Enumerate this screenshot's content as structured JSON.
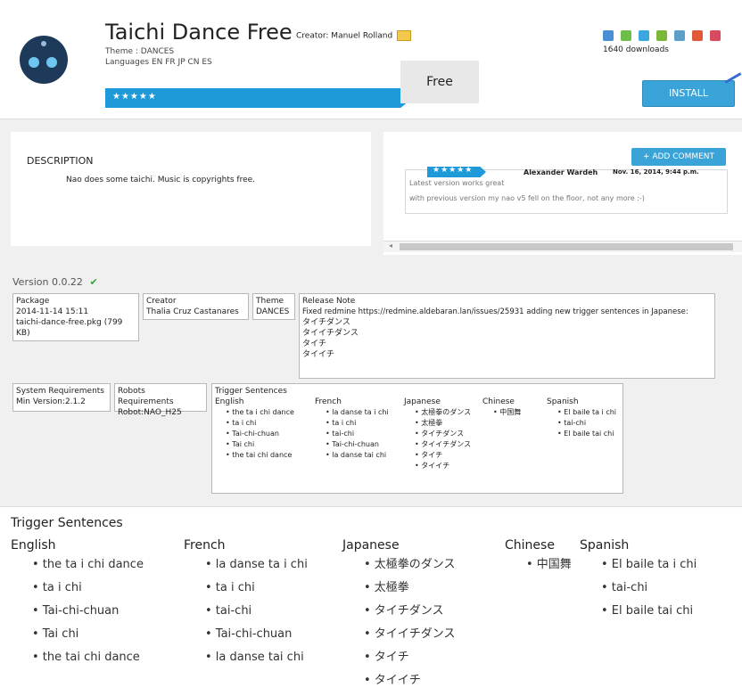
{
  "app": {
    "title": "Taichi Dance Free",
    "creator_label": "Creator: Manuel Rolland",
    "theme_line": "Theme : DANCES",
    "languages_line": "Languages EN FR JP CN ES",
    "price": "Free",
    "stars": "★★★★★",
    "downloads": "1640 downloads",
    "install_label": "INSTALL",
    "brand_color": "#1e9ad8"
  },
  "description": {
    "heading": "DESCRIPTION",
    "text": "Nao does some taichi. Music is copyrights free."
  },
  "comments": {
    "add_label": "+ ADD COMMENT",
    "stars": "★★★★★",
    "author": "Alexander Wardeh",
    "date": "Nov. 16, 2014, 9:44 p.m.",
    "line1": "Latest version works great",
    "line2": "with previous version my nao v5 fell on the floor, not any more :-)"
  },
  "version": {
    "label": "Version 0.0.22",
    "check": "✔"
  },
  "table1": {
    "package_h": "Package",
    "package_date": "2014-11-14 15:11",
    "package_file": "taichi-dance-free.pkg (799 KB)",
    "creator_h": "Creator",
    "creator_v": "Thalia Cruz Castanares",
    "theme_h": "Theme",
    "theme_v": "DANCES",
    "release_h": "Release Note",
    "release_v": "Fixed redmine https://redmine.aldebaran.lan/issues/25931 adding new trigger sentences in Japanese:",
    "release_lines": [
      "タイチダンス",
      "タイイチダンス",
      "タイチ",
      "タイイチ"
    ]
  },
  "table2": {
    "sysreq_h": "System Requirements",
    "sysreq_v": "Min Version:2.1.2",
    "robots_h": "Robots Requirements",
    "robots_v": "Robot:NAO_H25",
    "trigger_h": "Trigger Sentences"
  },
  "triggers": {
    "title": "Trigger Sentences",
    "columns": [
      {
        "lang": "English",
        "items": [
          "the ta i chi dance",
          "ta i chi",
          "Tai-chi-chuan",
          "Tai chi",
          "the tai chi dance"
        ]
      },
      {
        "lang": "French",
        "items": [
          "la danse ta i chi",
          "ta i chi",
          "tai-chi",
          "Tai-chi-chuan",
          "la danse tai chi"
        ]
      },
      {
        "lang": "Japanese",
        "items": [
          "太極拳のダンス",
          "太極拳",
          "タイチダンス",
          "タイイチダンス",
          "タイチ",
          "タイイチ"
        ]
      },
      {
        "lang": "Chinese",
        "items": [
          "中国舞"
        ]
      },
      {
        "lang": "Spanish",
        "items": [
          "El baile ta i chi",
          "tai-chi",
          "El baile tai chi"
        ]
      }
    ]
  }
}
